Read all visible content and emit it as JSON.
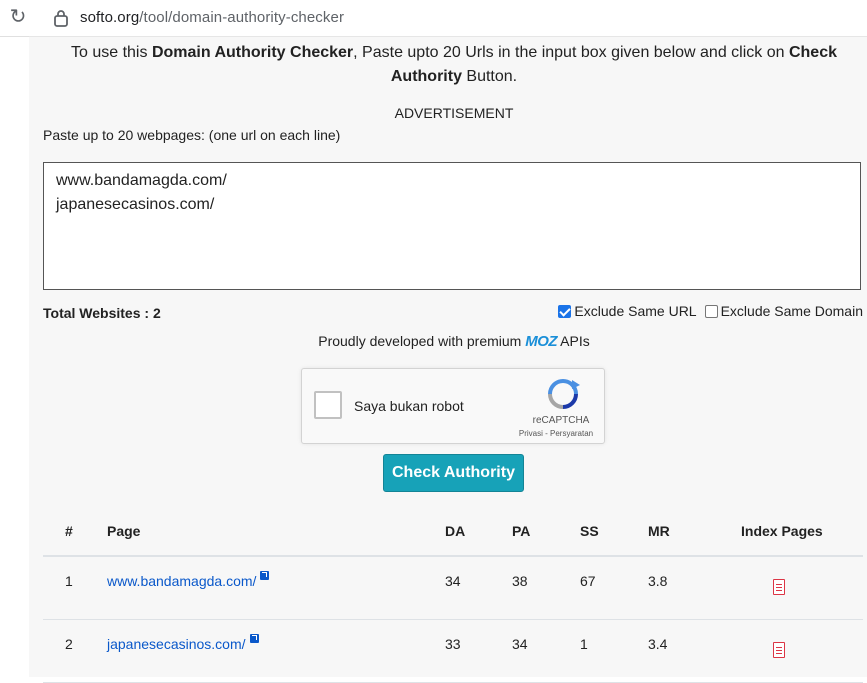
{
  "browser": {
    "url_domain": "softo.org",
    "url_path": "/tool/domain-authority-checker"
  },
  "intro": {
    "part1": "To use this ",
    "bold1": "Domain Authority Checker",
    "part2": ", Paste upto 20 Urls in the input box given below and click on ",
    "bold2": "Check Authority",
    "part3": " Button."
  },
  "advertisement": "ADVERTISEMENT",
  "paste_label": "Paste up to 20 webpages: (one url on each line)",
  "textarea_lines": [
    "www.bandamagda.com/",
    "japanesecasinos.com/"
  ],
  "total_websites": "Total Websites : 2",
  "options": {
    "exclude_url": {
      "label": "Exclude Same URL",
      "checked": true
    },
    "exclude_domain": {
      "label": "Exclude Same Domain",
      "checked": false
    }
  },
  "proud": {
    "prefix": "Proudly developed with premium ",
    "brand": "MOZ",
    "suffix": " APIs"
  },
  "captcha": {
    "label": "Saya bukan robot",
    "brand": "reCAPTCHA",
    "links": "Privasi - Persyaratan"
  },
  "check_button": "Check Authority",
  "table": {
    "headers": {
      "num": "#",
      "page": "Page",
      "da": "DA",
      "pa": "PA",
      "ss": "SS",
      "mr": "MR",
      "index": "Index Pages"
    },
    "rows": [
      {
        "num": "1",
        "page": "www.bandamagda.com/",
        "da": "34",
        "pa": "38",
        "ss": "67",
        "mr": "3.8"
      },
      {
        "num": "2",
        "page": "japanesecasinos.com/",
        "da": "33",
        "pa": "34",
        "ss": "1",
        "mr": "3.4"
      }
    ]
  },
  "colors": {
    "button": "#17a2b8",
    "link": "#0a58ca",
    "doc_icon": "#dc3545",
    "moz": "#1a8fd8"
  }
}
